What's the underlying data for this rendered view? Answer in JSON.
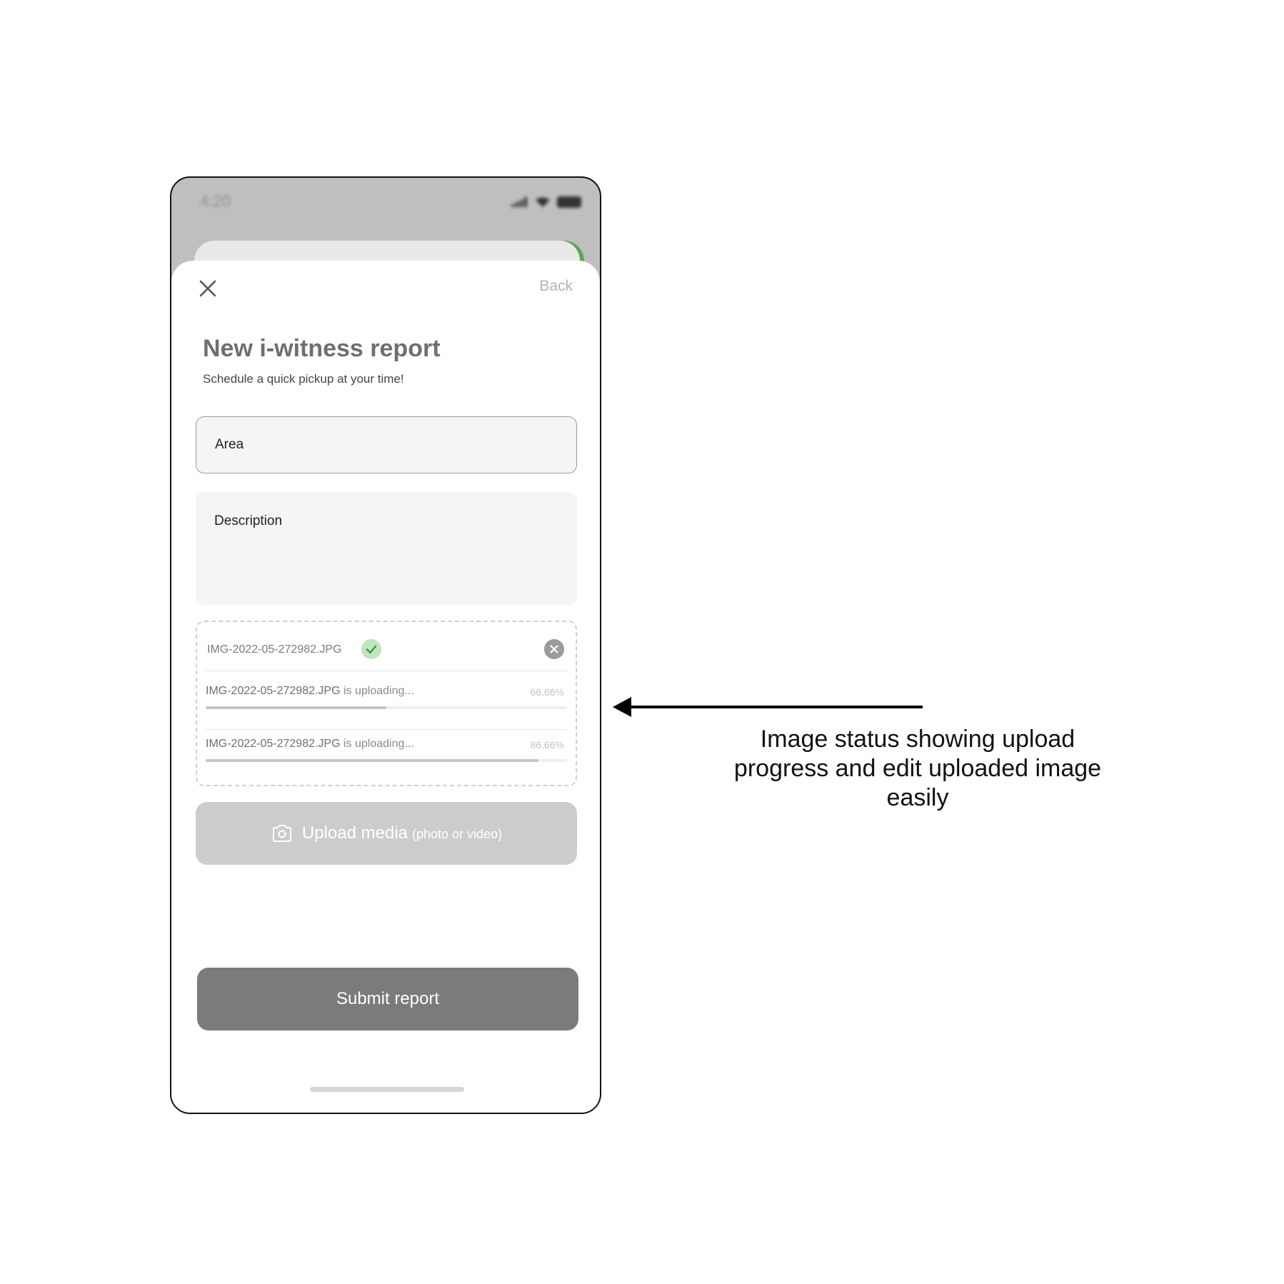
{
  "status_bar": {
    "time": "4:20"
  },
  "header": {
    "back_label": "Back"
  },
  "form": {
    "title": "New i-witness report",
    "subtitle": "Schedule a quick pickup at your time!",
    "area_placeholder": "Area",
    "description_placeholder": "Description"
  },
  "uploads": {
    "completed": {
      "file_name": "IMG-2022-05-272982.JPG"
    },
    "in_progress": [
      {
        "file_name": "IMG-2022-05-272982.JPG",
        "status": "is uploading...",
        "percent_label": "66.66%",
        "progress": 0.5
      },
      {
        "file_name": "IMG-2022-05-272982.JPG",
        "status": "is uploading...",
        "percent_label": "86.66%",
        "progress": 0.92
      }
    ]
  },
  "upload_button": {
    "label": "Upload media",
    "hint": "(photo or video)"
  },
  "submit_button": {
    "label": "Submit report"
  },
  "annotation": {
    "text": "Image status showing upload progress and edit uploaded image easily"
  },
  "colors": {
    "success_check_bg": "#bfe6bf",
    "success_check": "#3a9a3a",
    "submit_bg": "#7b7b7b",
    "upload_bg": "#cccccc"
  },
  "icons": [
    "close-icon",
    "check-icon",
    "remove-icon",
    "camera-icon",
    "signal-icon",
    "wifi-icon",
    "battery-icon"
  ]
}
